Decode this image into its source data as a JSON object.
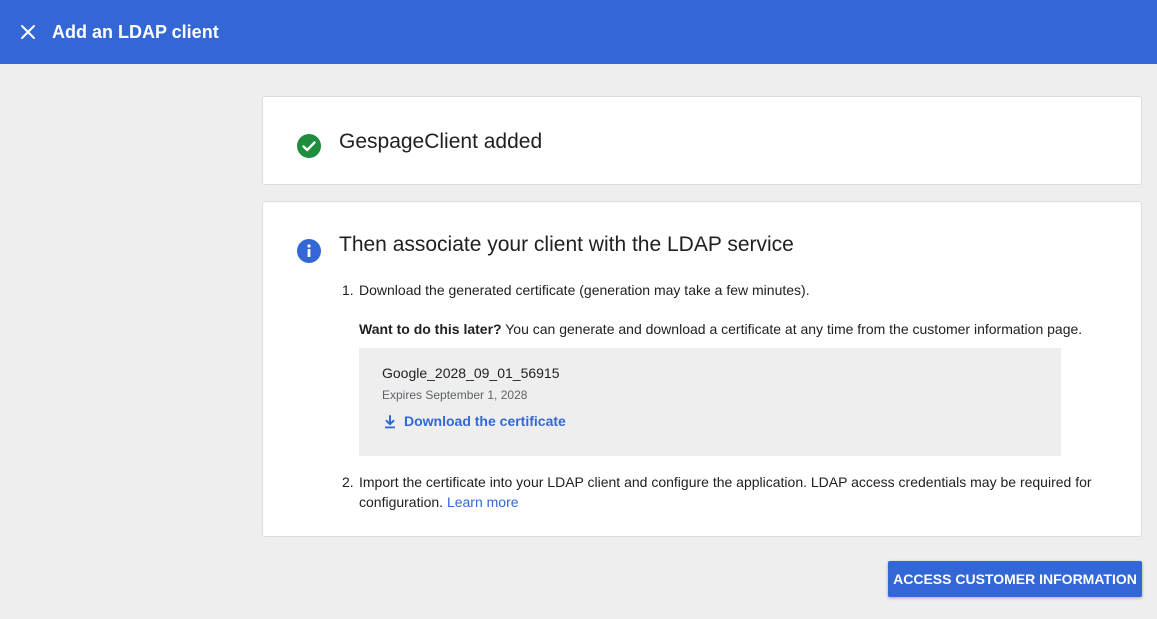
{
  "header": {
    "title": "Add an LDAP client",
    "close_icon": "close-icon"
  },
  "success_card": {
    "icon": "check-circle-icon",
    "title": "GespageClient added"
  },
  "steps_card": {
    "icon": "info-icon",
    "title": "Then associate your client with the LDAP service",
    "step1": {
      "number": "1.",
      "text": "Download the generated certificate (generation may take a few minutes).",
      "later_bold": "Want to do this later?",
      "later_text": " You can generate and download a certificate at any time from the customer information page.",
      "certificate": {
        "name": "Google_2028_09_01_56915",
        "expires": "Expires September 1, 2028",
        "download_icon": "download-icon",
        "download_label": "Download the certificate"
      }
    },
    "step2": {
      "number": "2.",
      "text": "Import the certificate into your LDAP client and configure the application. LDAP access credentials may be required for configuration. ",
      "link": "Learn more"
    }
  },
  "footer": {
    "primary_button": "ACCESS CUSTOMER INFORMATION"
  },
  "colors": {
    "brand_blue": "#3367d6",
    "success_green": "#1e8e3e",
    "background": "#eeeeee"
  }
}
